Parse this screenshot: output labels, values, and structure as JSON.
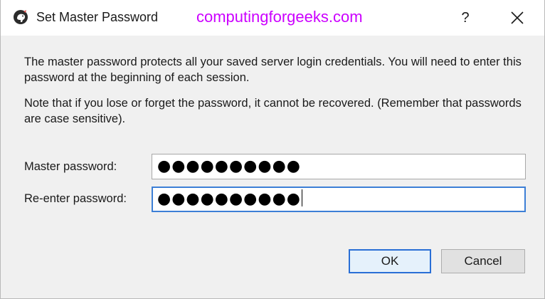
{
  "window": {
    "title": "Set Master Password",
    "watermark": "computingforgeeks.com",
    "help_label": "?",
    "close_icon": "close-icon",
    "app_icon": "pgadmin-elephant-icon"
  },
  "description": {
    "line1": "The master password protects all your saved server login credentials. You will need to enter this password at the beginning of each session.",
    "line2": "Note that if you lose or forget the password, it cannot be recovered. (Remember that passwords are case sensitive)."
  },
  "form": {
    "master_label": "Master password:",
    "master_value": "●●●●●●●●●●",
    "reenter_label": "Re-enter password:",
    "reenter_value": "●●●●●●●●●●"
  },
  "buttons": {
    "ok_label": "OK",
    "cancel_label": "Cancel"
  },
  "colors": {
    "watermark": "#cc00ff",
    "focus_border": "#3c7fd6",
    "background": "#f0f0f0"
  }
}
